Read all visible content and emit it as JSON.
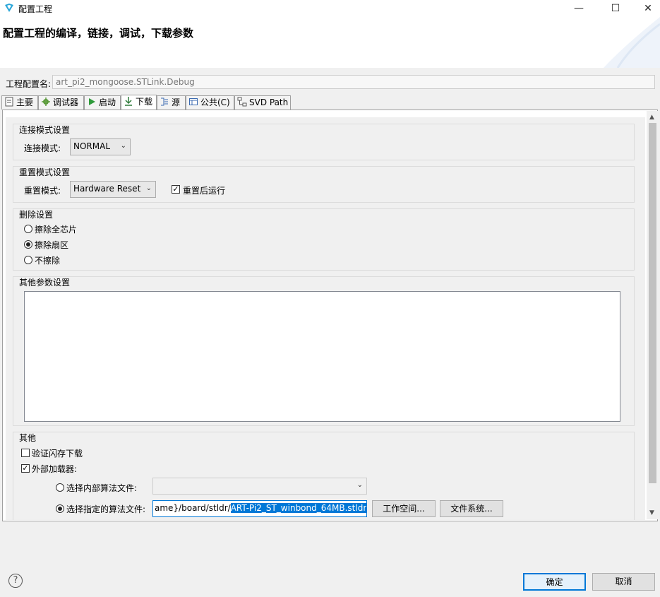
{
  "window": {
    "title": "配置工程",
    "minimize": "—",
    "maximize": "☐",
    "close": "✕"
  },
  "header": {
    "title": "配置工程的编译，链接，调试，下载参数"
  },
  "config": {
    "label": "工程配置名:",
    "value": "art_pi2_mongoose.STLink.Debug"
  },
  "tabs": [
    {
      "label": "主要",
      "icon": "document-icon"
    },
    {
      "label": "调试器",
      "icon": "gear-bug-icon"
    },
    {
      "label": "启动",
      "icon": "play-icon"
    },
    {
      "label": "下载",
      "icon": "download-icon"
    },
    {
      "label": "源",
      "icon": "source-icon"
    },
    {
      "label": "公共(C)",
      "icon": "table-icon"
    },
    {
      "label": "SVD Path",
      "icon": "tree-icon"
    }
  ],
  "connect": {
    "group_title": "连接模式设置",
    "mode_label": "连接模式:",
    "mode_value": "NORMAL"
  },
  "reset": {
    "group_title": "重置模式设置",
    "mode_label": "重置模式:",
    "mode_value": "Hardware Reset",
    "run_after_reset_label": "重置后运行",
    "run_after_reset_checked": true
  },
  "erase": {
    "group_title": "删除设置",
    "options": [
      {
        "label": "擦除全芯片",
        "selected": false
      },
      {
        "label": "擦除扇区",
        "selected": true
      },
      {
        "label": "不擦除",
        "selected": false
      }
    ]
  },
  "other_params": {
    "group_title": "其他参数设置",
    "text": ""
  },
  "misc": {
    "group_title": "其他",
    "verify_label": "验证闪存下载",
    "verify_checked": false,
    "external_loader_label": "外部加载器:",
    "external_loader_checked": true,
    "internal_algo_label": "选择内部算法文件:",
    "internal_algo_selected": false,
    "internal_algo_value": "",
    "custom_algo_label": "选择指定的算法文件:",
    "custom_algo_selected": true,
    "custom_algo_path_prefix": "ame}/board/stldr/",
    "custom_algo_path_selected": "ART-Pi2_ST_winbond_64MB.stldr",
    "workspace_button": "工作空间...",
    "filesystem_button": "文件系统..."
  },
  "footer": {
    "help": "?",
    "ok": "确定",
    "cancel": "取消"
  },
  "colors": {
    "selection": "#0078d7",
    "accent_border": "#0078d7"
  }
}
